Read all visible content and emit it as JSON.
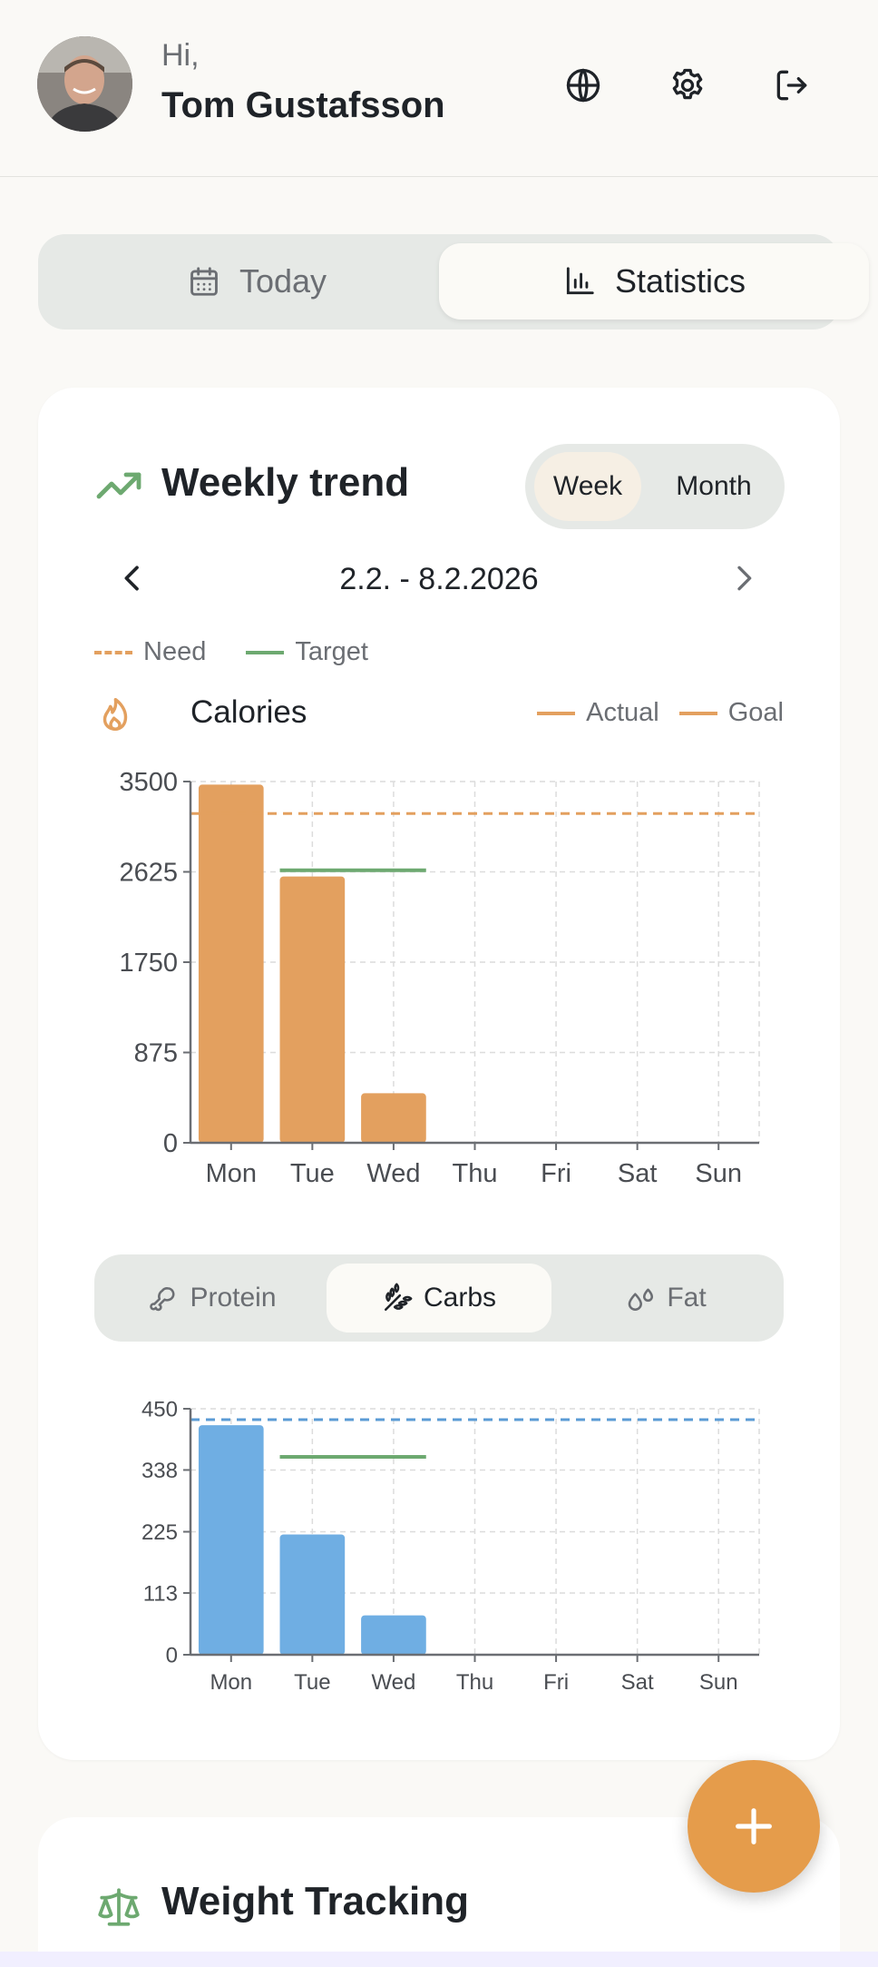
{
  "header": {
    "greeting": "Hi,",
    "username": "Tom Gustafsson",
    "icons": [
      "globe-icon",
      "gear-icon",
      "logout-icon"
    ]
  },
  "tabs": {
    "today": "Today",
    "statistics": "Statistics",
    "active": "statistics"
  },
  "trend": {
    "title": "Weekly trend",
    "period": {
      "week": "Week",
      "month": "Month",
      "active": "week"
    },
    "date_range": "2.2. - 8.2.2026",
    "legend": {
      "need": "Need",
      "target": "Target"
    },
    "calories": {
      "title": "Calories",
      "legend_actual": "Actual",
      "legend_goal": "Goal"
    },
    "macro_tabs": {
      "protein": "Protein",
      "carbs": "Carbs",
      "fat": "Fat",
      "active": "carbs"
    }
  },
  "weight": {
    "title": "Weight Tracking"
  },
  "colors": {
    "calories": "#e3a05f",
    "carbs": "#6faee3",
    "target": "#6da970",
    "need_calories": "#e3a05f",
    "need_carbs": "#5b9bd5"
  },
  "chart_data": [
    {
      "type": "bar",
      "title": "Calories",
      "categories": [
        "Mon",
        "Tue",
        "Wed",
        "Thu",
        "Fri",
        "Sat",
        "Sun"
      ],
      "series": [
        {
          "name": "Actual",
          "values": [
            3470,
            2580,
            480,
            0,
            0,
            0,
            0
          ]
        }
      ],
      "need": 3190,
      "target": {
        "value": 2640,
        "from": "Tue",
        "to": "Wed"
      },
      "ylim": [
        0,
        3500
      ],
      "yticks": [
        0,
        875,
        1750,
        2625,
        3500
      ],
      "grid": true
    },
    {
      "type": "bar",
      "title": "Carbs",
      "categories": [
        "Mon",
        "Tue",
        "Wed",
        "Thu",
        "Fri",
        "Sat",
        "Sun"
      ],
      "series": [
        {
          "values": [
            420,
            220,
            72,
            0,
            0,
            0,
            0
          ]
        }
      ],
      "need": 430,
      "target": {
        "value": 362,
        "from": "Tue",
        "to": "Wed"
      },
      "ylim": [
        0,
        450
      ],
      "yticks": [
        0,
        113,
        225,
        338,
        450
      ],
      "grid": true
    }
  ]
}
